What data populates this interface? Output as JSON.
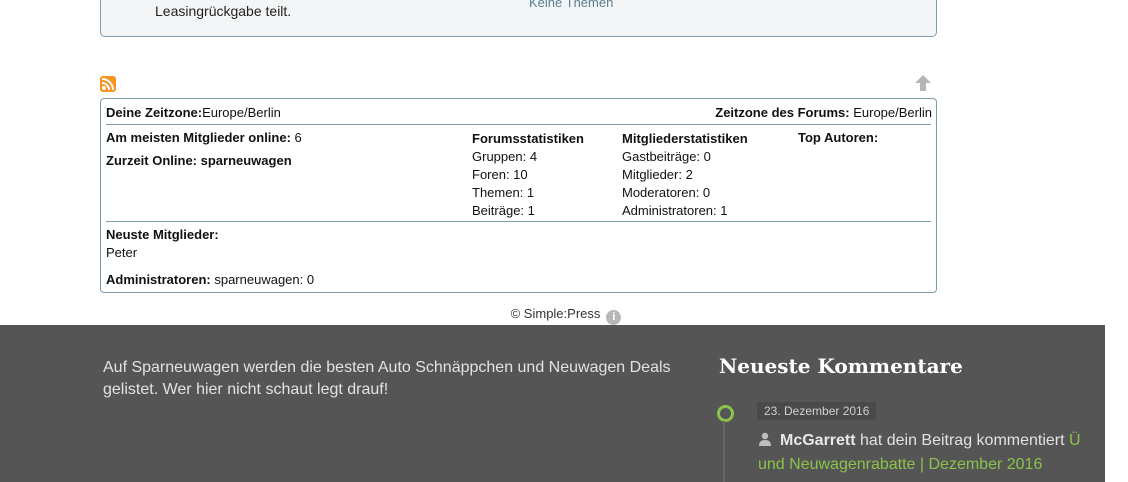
{
  "top_box": {
    "text": "Leasingrückgabe teilt.",
    "link": "Keine Themen"
  },
  "stats": {
    "user_tz_label": "Deine Zeitzone:",
    "user_tz_value": "Europe/Berlin",
    "forum_tz_label": "Zeitzone des Forums:",
    "forum_tz_value": " Europe/Berlin",
    "most_online_label": "Am meisten Mitglieder online:",
    "most_online_value": " 6",
    "currently_online": "Zurzeit Online: sparneuwagen",
    "forum_stats": {
      "heading": "Forumsstatistiken",
      "groups": "Gruppen: 4",
      "forums": "Foren: 10",
      "topics": "Themen: 1",
      "posts": "Beiträge: 1"
    },
    "member_stats": {
      "heading": "Mitgliederstatistiken",
      "guest_posts": "Gastbeiträge: 0",
      "members": "Mitglieder: 2",
      "moderators": "Moderatoren: 0",
      "admins": "Administratoren: 1"
    },
    "top_authors": "Top Autoren:",
    "newest_members_label": "Neuste Mitglieder:",
    "newest_members_value": "Peter",
    "administrators_label": "Administratoren:",
    "administrators_value": " sparneuwagen: 0"
  },
  "copyright": "© Simple:Press",
  "footer": {
    "about": "Auf Sparneuwagen werden die besten Auto Schnäppchen und Neuwagen Deals gelistet. Wer hier nicht schaut legt drauf!",
    "comments_heading": "Neueste Kommentare",
    "comment": {
      "date": "23. Dezember 2016",
      "author": "McGarrett",
      "action": " hat dein Beitrag kommentiert ",
      "post": "Ü und Neuwagenrabatte | Dezember 2016"
    }
  },
  "colors": {
    "accent": "#8bc34a",
    "border": "#7a9cae",
    "footer_bg": "#555555",
    "rss": "#f7931e"
  },
  "icons": [
    "rss-icon",
    "scroll-up-icon",
    "info-icon",
    "user-icon",
    "timeline-dot-icon"
  ]
}
